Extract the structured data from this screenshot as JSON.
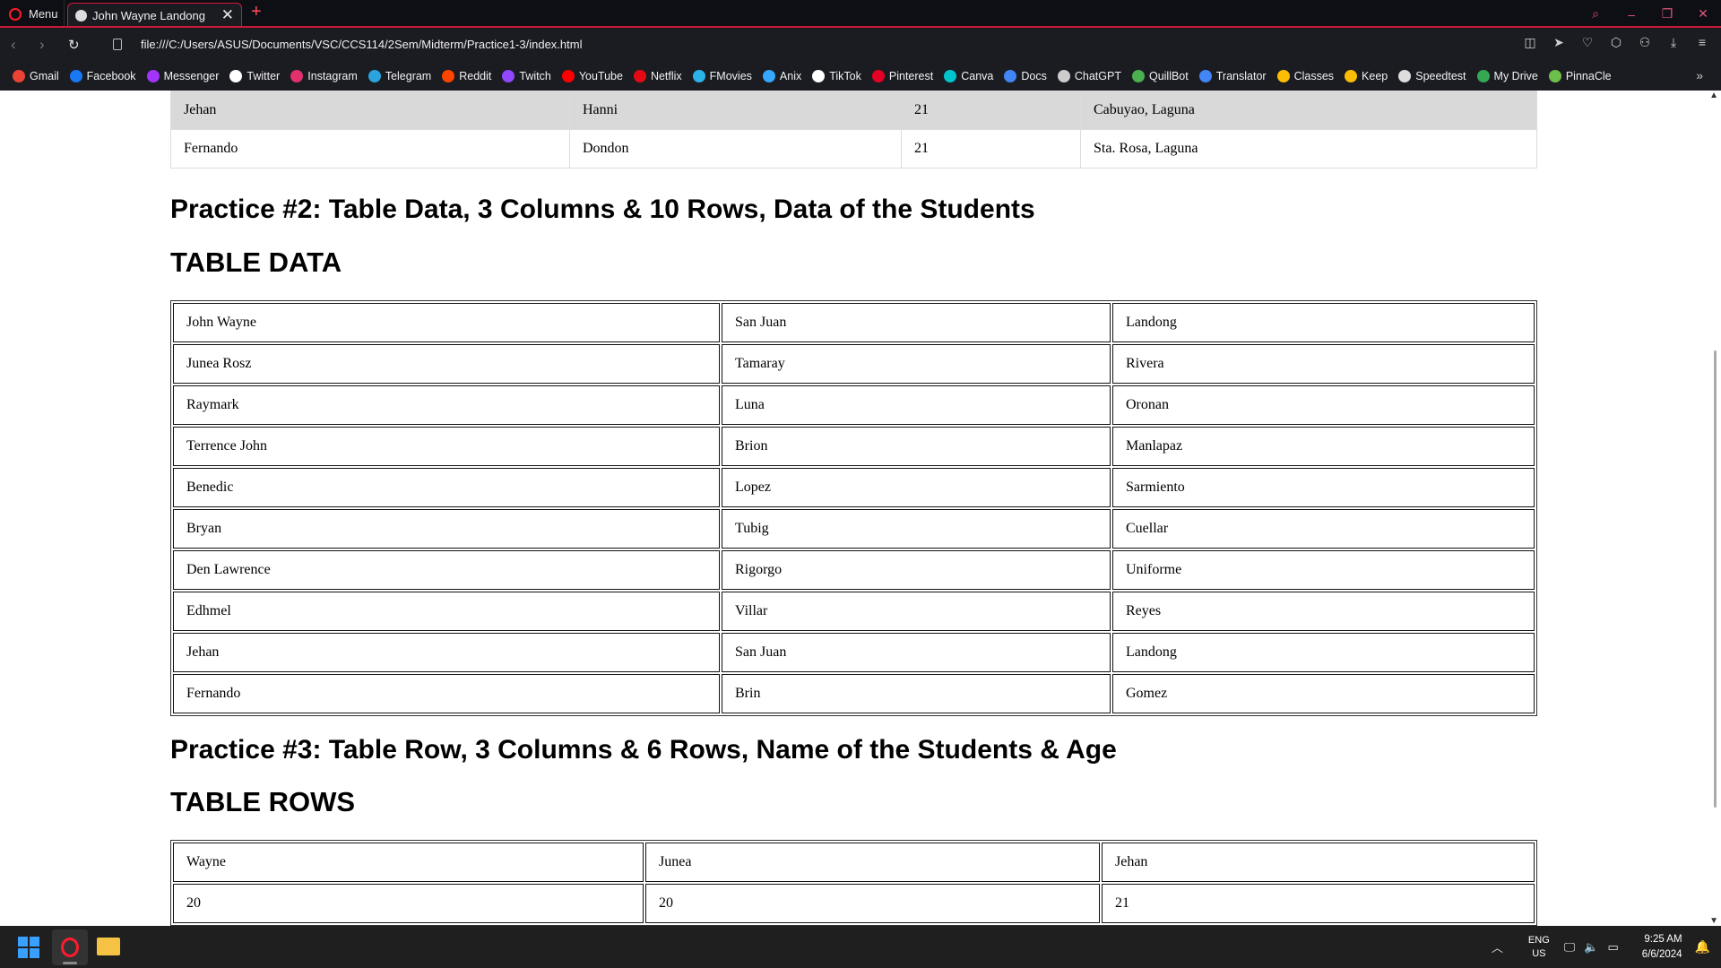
{
  "browser": {
    "menu_label": "Menu",
    "tab_title": "John Wayne Landong",
    "url": "file:///C:/Users/ASUS/Documents/VSC/CCS114/2Sem/Midterm/Practice1-3/index.html",
    "accent_color": "#d0163a",
    "bookmarks": [
      {
        "label": "Gmail",
        "color": "#ea4335"
      },
      {
        "label": "Facebook",
        "color": "#1877f2"
      },
      {
        "label": "Messenger",
        "color": "#a334fa"
      },
      {
        "label": "Twitter",
        "color": "#ffffff"
      },
      {
        "label": "Instagram",
        "color": "#e1306c"
      },
      {
        "label": "Telegram",
        "color": "#2aa3df"
      },
      {
        "label": "Reddit",
        "color": "#ff4500"
      },
      {
        "label": "Twitch",
        "color": "#9146ff"
      },
      {
        "label": "YouTube",
        "color": "#ff0000"
      },
      {
        "label": "Netflix",
        "color": "#e50914"
      },
      {
        "label": "FMovies",
        "color": "#2bb3e8"
      },
      {
        "label": "Anix",
        "color": "#35a7ff"
      },
      {
        "label": "TikTok",
        "color": "#ffffff"
      },
      {
        "label": "Pinterest",
        "color": "#e60023"
      },
      {
        "label": "Canva",
        "color": "#00c4cc"
      },
      {
        "label": "Docs",
        "color": "#4285f4"
      },
      {
        "label": "ChatGPT",
        "color": "#cccccc"
      },
      {
        "label": "QuillBot",
        "color": "#4caf50"
      },
      {
        "label": "Translator",
        "color": "#4285f4"
      },
      {
        "label": "Classes",
        "color": "#fbbc04"
      },
      {
        "label": "Keep",
        "color": "#fbbc04"
      },
      {
        "label": "Speedtest",
        "color": "#dddddd"
      },
      {
        "label": "My Drive",
        "color": "#34a853"
      },
      {
        "label": "PinnaCle",
        "color": "#6dbf4b"
      }
    ]
  },
  "page": {
    "table1_rows": [
      [
        "Jehan",
        "Hanni",
        "21",
        "Cabuyao, Laguna"
      ],
      [
        "Fernando",
        "Dondon",
        "21",
        "Sta. Rosa, Laguna"
      ]
    ],
    "practice2_heading": "Practice #2: Table Data, 3 Columns & 10 Rows, Data of the Students",
    "practice2_title": "TABLE DATA",
    "table2_rows": [
      [
        "John Wayne",
        "San Juan",
        "Landong"
      ],
      [
        "Junea Rosz",
        "Tamaray",
        "Rivera"
      ],
      [
        "Raymark",
        "Luna",
        "Oronan"
      ],
      [
        "Terrence John",
        "Brion",
        "Manlapaz"
      ],
      [
        "Benedic",
        "Lopez",
        "Sarmiento"
      ],
      [
        "Bryan",
        "Tubig",
        "Cuellar"
      ],
      [
        "Den Lawrence",
        "Rigorgo",
        "Uniforme"
      ],
      [
        "Edhmel",
        "Villar",
        "Reyes"
      ],
      [
        "Jehan",
        "San Juan",
        "Landong"
      ],
      [
        "Fernando",
        "Brin",
        "Gomez"
      ]
    ],
    "practice3_heading": "Practice #3: Table Row, 3 Columns & 6 Rows, Name of the Students & Age",
    "practice3_title": "TABLE ROWS",
    "table3_rows": [
      [
        "Wayne",
        "Junea",
        "Jehan"
      ],
      [
        "20",
        "20",
        "21"
      ]
    ]
  },
  "taskbar": {
    "lang_line1": "ENG",
    "lang_line2": "US",
    "time": "9:25 AM",
    "date": "6/6/2024"
  }
}
